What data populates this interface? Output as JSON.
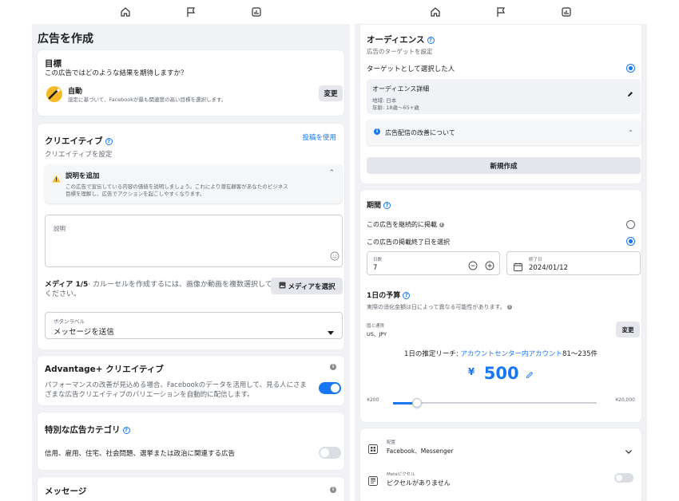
{
  "left": {
    "page_title": "広告を作成",
    "objective": {
      "title": "目標",
      "question": "この広告ではどのような結果を期待しますか？",
      "option_title": "自動",
      "option_desc": "設定に基づいて、Facebookが最も関連度の高い目標を選択します。",
      "change_label": "変更"
    },
    "creative": {
      "title": "クリエイティブ",
      "use_post_label": "投稿を使用",
      "subtitle": "クリエイティブを設定",
      "warning_title": "説明を追加",
      "warning_text_1": "この広告で宣伝している内容の価値を説明しましょう。これにより潜在顧客があなたのビジネス",
      "warning_text_2": "目標を理解し、広告でアクションを起こしやすくなります。",
      "description_label": "説明",
      "media_label": "メディア 1/5",
      "media_hint_1": "· カルーセルを作成するには、画像か動画を複数選択して",
      "media_hint_2": "ください。",
      "select_media_label": "メディアを選択",
      "button_label_caption": "ボタンラベル",
      "button_label_value": "メッセージを送信"
    },
    "advantage": {
      "title": "Advantage+ クリエイティブ",
      "desc_1": "パフォーマンスの改善が見込める場合、Facebookのデータを活用して、見る人にさま",
      "desc_2": "ざまな広告クリエイティブのバリエーションを自動的に配信します。",
      "enabled": true
    },
    "special": {
      "title": "特別な広告カテゴリ",
      "desc": "信用、雇用、住宅、社会問題、選挙または政治に関連する広告",
      "enabled": false
    },
    "message": {
      "title": "メッセージ"
    }
  },
  "right": {
    "audience": {
      "title": "オーディエンス",
      "subtitle": "広告のターゲットを設定",
      "option": "ターゲットとして選択した人",
      "detail_title": "オーディエンス詳細",
      "region": "地域: 日本",
      "age": "年齢: 18歳～65+歳",
      "delivery_label": "広告配信の改善について",
      "create_new_label": "新規作成"
    },
    "duration": {
      "title": "期間",
      "option_continuous": "この広告を継続的に掲載",
      "option_end_date": "この広告の掲載終了日を選択",
      "days_caption": "日数",
      "days_value": "7",
      "end_date_caption": "終了日",
      "end_date_value": "2024/01/12"
    },
    "budget": {
      "title": "1日の予算",
      "note": "実際の消化金額は日によって異なる可能性があります。",
      "country_caption": "国と通貨",
      "country_value": "US、JPY",
      "change_label": "変更",
      "reach_prefix": "1日の推定リーチ: ",
      "reach_link": "アカウントセンター内アカウント",
      "reach_range": "81～235件",
      "currency": "¥",
      "amount": "500",
      "min_label": "¥200",
      "max_label": "¥20,000",
      "slider_fraction": 0.013
    },
    "placement": {
      "caption": "配置",
      "value": "Facebook、Messenger"
    },
    "pixel": {
      "caption": "Metaピクセル",
      "value": "ピクセルがありません",
      "enabled": false
    }
  },
  "colors": {
    "accent": "#1877f2",
    "background": "#f0f2f5",
    "warning": "#f7b928"
  }
}
